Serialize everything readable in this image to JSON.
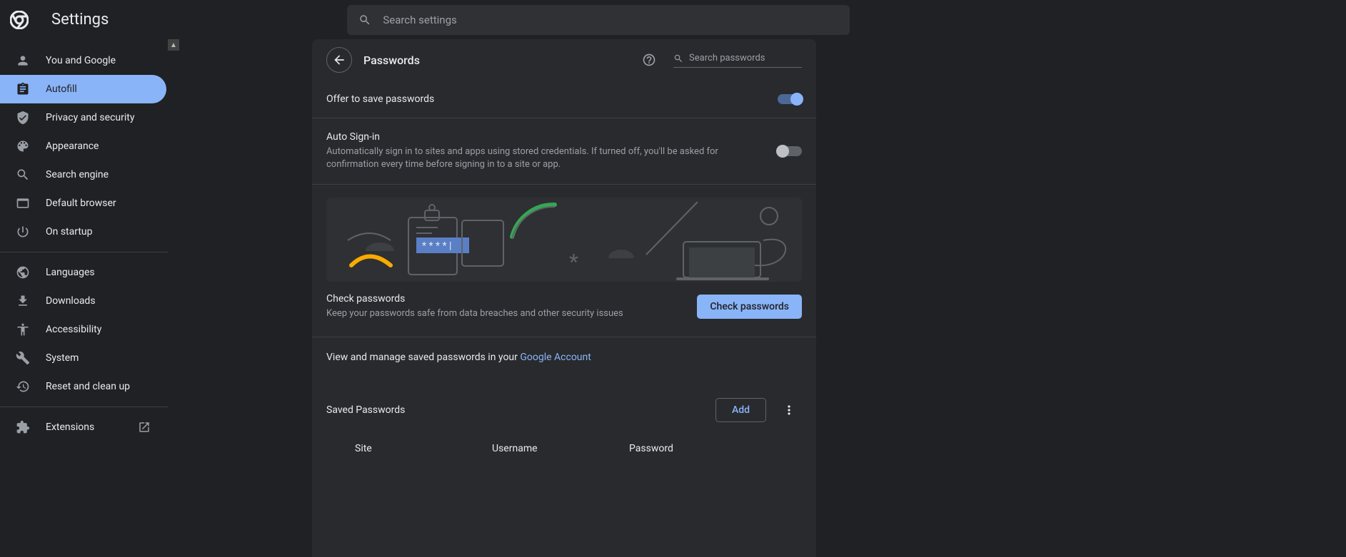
{
  "app": {
    "title": "Settings"
  },
  "search": {
    "placeholder": "Search settings"
  },
  "sidebar": {
    "items": [
      {
        "label": "You and Google"
      },
      {
        "label": "Autofill",
        "active": true
      },
      {
        "label": "Privacy and security"
      },
      {
        "label": "Appearance"
      },
      {
        "label": "Search engine"
      },
      {
        "label": "Default browser"
      },
      {
        "label": "On startup"
      }
    ],
    "advanced": [
      {
        "label": "Languages"
      },
      {
        "label": "Downloads"
      },
      {
        "label": "Accessibility"
      },
      {
        "label": "System"
      },
      {
        "label": "Reset and clean up"
      }
    ],
    "extensions": {
      "label": "Extensions"
    }
  },
  "page": {
    "title": "Passwords",
    "search_placeholder": "Search passwords"
  },
  "toggles": {
    "offer_save": {
      "title": "Offer to save passwords",
      "value": true
    },
    "auto_signin": {
      "title": "Auto Sign-in",
      "sub": "Automatically sign in to sites and apps using stored credentials. If turned off, you'll be asked for confirmation every time before signing in to a site or app.",
      "value": false
    }
  },
  "check": {
    "title": "Check passwords",
    "sub": "Keep your passwords safe from data breaches and other security issues",
    "button": "Check passwords"
  },
  "manage_line": {
    "prefix": "View and manage saved passwords in your ",
    "link": "Google Account"
  },
  "saved": {
    "heading": "Saved Passwords",
    "add": "Add",
    "columns": {
      "site": "Site",
      "username": "Username",
      "password": "Password"
    }
  },
  "colors": {
    "accent": "#8ab4f8"
  }
}
